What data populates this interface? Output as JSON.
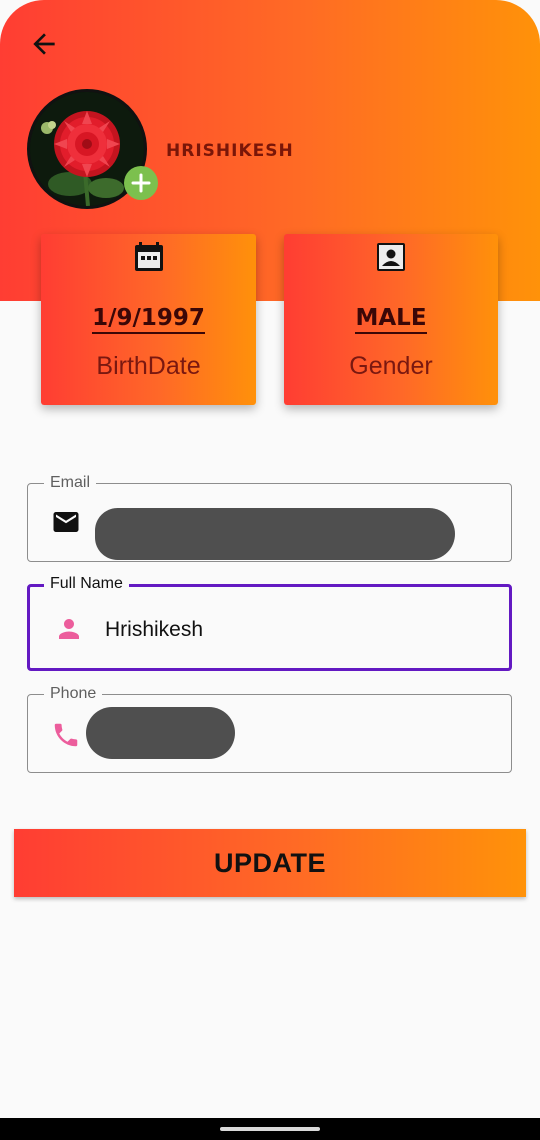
{
  "profile": {
    "name": "HRISHIKESH"
  },
  "cards": {
    "birthdate": {
      "value": "1/9/1997",
      "label": "BirthDate",
      "icon": "calendar-icon"
    },
    "gender": {
      "value": "MALE",
      "label": "Gender",
      "icon": "contact-card-icon"
    }
  },
  "form": {
    "email": {
      "label": "Email",
      "value": "",
      "icon": "mail-icon"
    },
    "full_name": {
      "label": "Full Name",
      "value": "Hrishikesh",
      "icon": "person-icon"
    },
    "phone": {
      "label": "Phone",
      "value": "",
      "icon": "phone-icon"
    }
  },
  "actions": {
    "update_label": "UPDATE"
  },
  "colors": {
    "gradient_start": "#ff3d33",
    "gradient_end": "#ff9209",
    "focus_border": "#6319c2",
    "icon_pink": "#ec5d9c",
    "add_photo_green": "#7cc04e",
    "name_text": "#7a1608"
  }
}
